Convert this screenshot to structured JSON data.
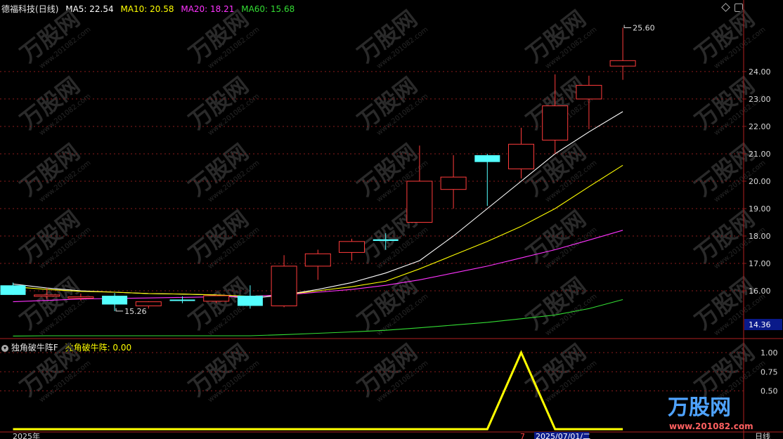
{
  "stock": {
    "name": "德福科技",
    "period": "(日线)"
  },
  "ma_legend": [
    {
      "label": "MA5: 22.54",
      "color": "#ffffff"
    },
    {
      "label": "MA10: 20.58",
      "color": "#ffff00"
    },
    {
      "label": "MA20: 18.21",
      "color": "#ff33ff"
    },
    {
      "label": "MA60: 15.68",
      "color": "#33dd33"
    }
  ],
  "indicator": {
    "name": "独角破牛阵F",
    "label": "独角破牛阵: 0.00",
    "color": "#ffff00"
  },
  "bottom_axis": {
    "year": "2025年",
    "mid": "7",
    "date": "2025/07/01/二",
    "period_tab": "日线"
  },
  "watermark": {
    "brand": "万股网",
    "url": "www.201082.com"
  },
  "colors": {
    "up": "#ff3b3b",
    "down": "#54ffff",
    "grid": "#8a1c1c",
    "axis_text": "#d8d8d8"
  },
  "chart_data": {
    "type": "candlestick",
    "price_axis": {
      "ticks": [
        "16.00",
        "17.00",
        "18.00",
        "19.00",
        "20.00",
        "21.00",
        "22.00",
        "23.00",
        "24.00"
      ],
      "ylim": [
        14.36,
        26.1
      ],
      "current_label": "14.36"
    },
    "candles": [
      {
        "o": 16.2,
        "h": 16.3,
        "l": 15.85,
        "c": 15.85
      },
      {
        "o": 15.82,
        "h": 16.1,
        "l": 15.7,
        "c": 15.85
      },
      {
        "o": 15.76,
        "h": 15.9,
        "l": 15.65,
        "c": 15.78
      },
      {
        "o": 15.82,
        "h": 15.92,
        "l": 15.26,
        "c": 15.5
      },
      {
        "o": 15.45,
        "h": 15.62,
        "l": 15.35,
        "c": 15.6
      },
      {
        "o": 15.68,
        "h": 15.8,
        "l": 15.55,
        "c": 15.63
      },
      {
        "o": 15.62,
        "h": 15.85,
        "l": 15.55,
        "c": 15.82
      },
      {
        "o": 15.82,
        "h": 16.2,
        "l": 15.35,
        "c": 15.45
      },
      {
        "o": 15.45,
        "h": 17.3,
        "l": 15.4,
        "c": 16.9
      },
      {
        "o": 16.9,
        "h": 17.5,
        "l": 16.4,
        "c": 17.35
      },
      {
        "o": 17.4,
        "h": 17.9,
        "l": 17.1,
        "c": 17.8
      },
      {
        "o": 17.88,
        "h": 18.1,
        "l": 17.5,
        "c": 17.82
      },
      {
        "o": 18.5,
        "h": 21.3,
        "l": 18.5,
        "c": 20.0
      },
      {
        "o": 19.7,
        "h": 20.95,
        "l": 19.0,
        "c": 20.15
      },
      {
        "o": 20.95,
        "h": 21.0,
        "l": 19.1,
        "c": 20.7
      },
      {
        "o": 20.45,
        "h": 21.95,
        "l": 20.1,
        "c": 21.35
      },
      {
        "o": 21.5,
        "h": 23.9,
        "l": 21.0,
        "c": 22.75
      },
      {
        "o": 23.0,
        "h": 23.85,
        "l": 21.9,
        "c": 23.5
      },
      {
        "o": 24.2,
        "h": 25.6,
        "l": 23.7,
        "c": 24.4
      }
    ],
    "annotations": [
      {
        "index": 3,
        "price": 15.26,
        "label": "15.26"
      },
      {
        "index": 18,
        "price": 25.6,
        "label": "25.60"
      }
    ],
    "ma_lines": [
      {
        "name": "MA5",
        "color": "#ffffff",
        "values": [
          16.25,
          16.1,
          16.0,
          15.95,
          15.9,
          15.88,
          15.85,
          15.72,
          15.85,
          16.05,
          16.3,
          16.65,
          17.1,
          18.0,
          19.0,
          20.0,
          21.0,
          21.8,
          22.54
        ]
      },
      {
        "name": "MA10",
        "color": "#ffff00",
        "values": [
          16.15,
          16.05,
          15.98,
          15.95,
          15.9,
          15.88,
          15.85,
          15.8,
          15.85,
          16.0,
          16.15,
          16.35,
          16.8,
          17.3,
          17.8,
          18.35,
          19.0,
          19.8,
          20.58
        ]
      },
      {
        "name": "MA20",
        "color": "#ff33ff",
        "values": [
          15.6,
          15.65,
          15.7,
          15.72,
          15.74,
          15.76,
          15.78,
          15.8,
          15.85,
          15.95,
          16.05,
          16.2,
          16.4,
          16.65,
          16.9,
          17.2,
          17.5,
          17.85,
          18.21
        ]
      },
      {
        "name": "MA60",
        "color": "#33dd33",
        "values": [
          14.35,
          14.36,
          14.36,
          14.36,
          14.36,
          14.36,
          14.36,
          14.36,
          14.4,
          14.45,
          14.5,
          14.56,
          14.65,
          14.75,
          14.85,
          14.98,
          15.12,
          15.35,
          15.68
        ]
      }
    ],
    "indicator_axis": {
      "ticks": [
        "1.00",
        "0.75",
        "0.50"
      ],
      "ylim": [
        0,
        1.0
      ]
    },
    "indicator_values": [
      0,
      0,
      0,
      0,
      0,
      0,
      0,
      0,
      0,
      0,
      0,
      0,
      0,
      0,
      0,
      1,
      0,
      0,
      0
    ]
  }
}
